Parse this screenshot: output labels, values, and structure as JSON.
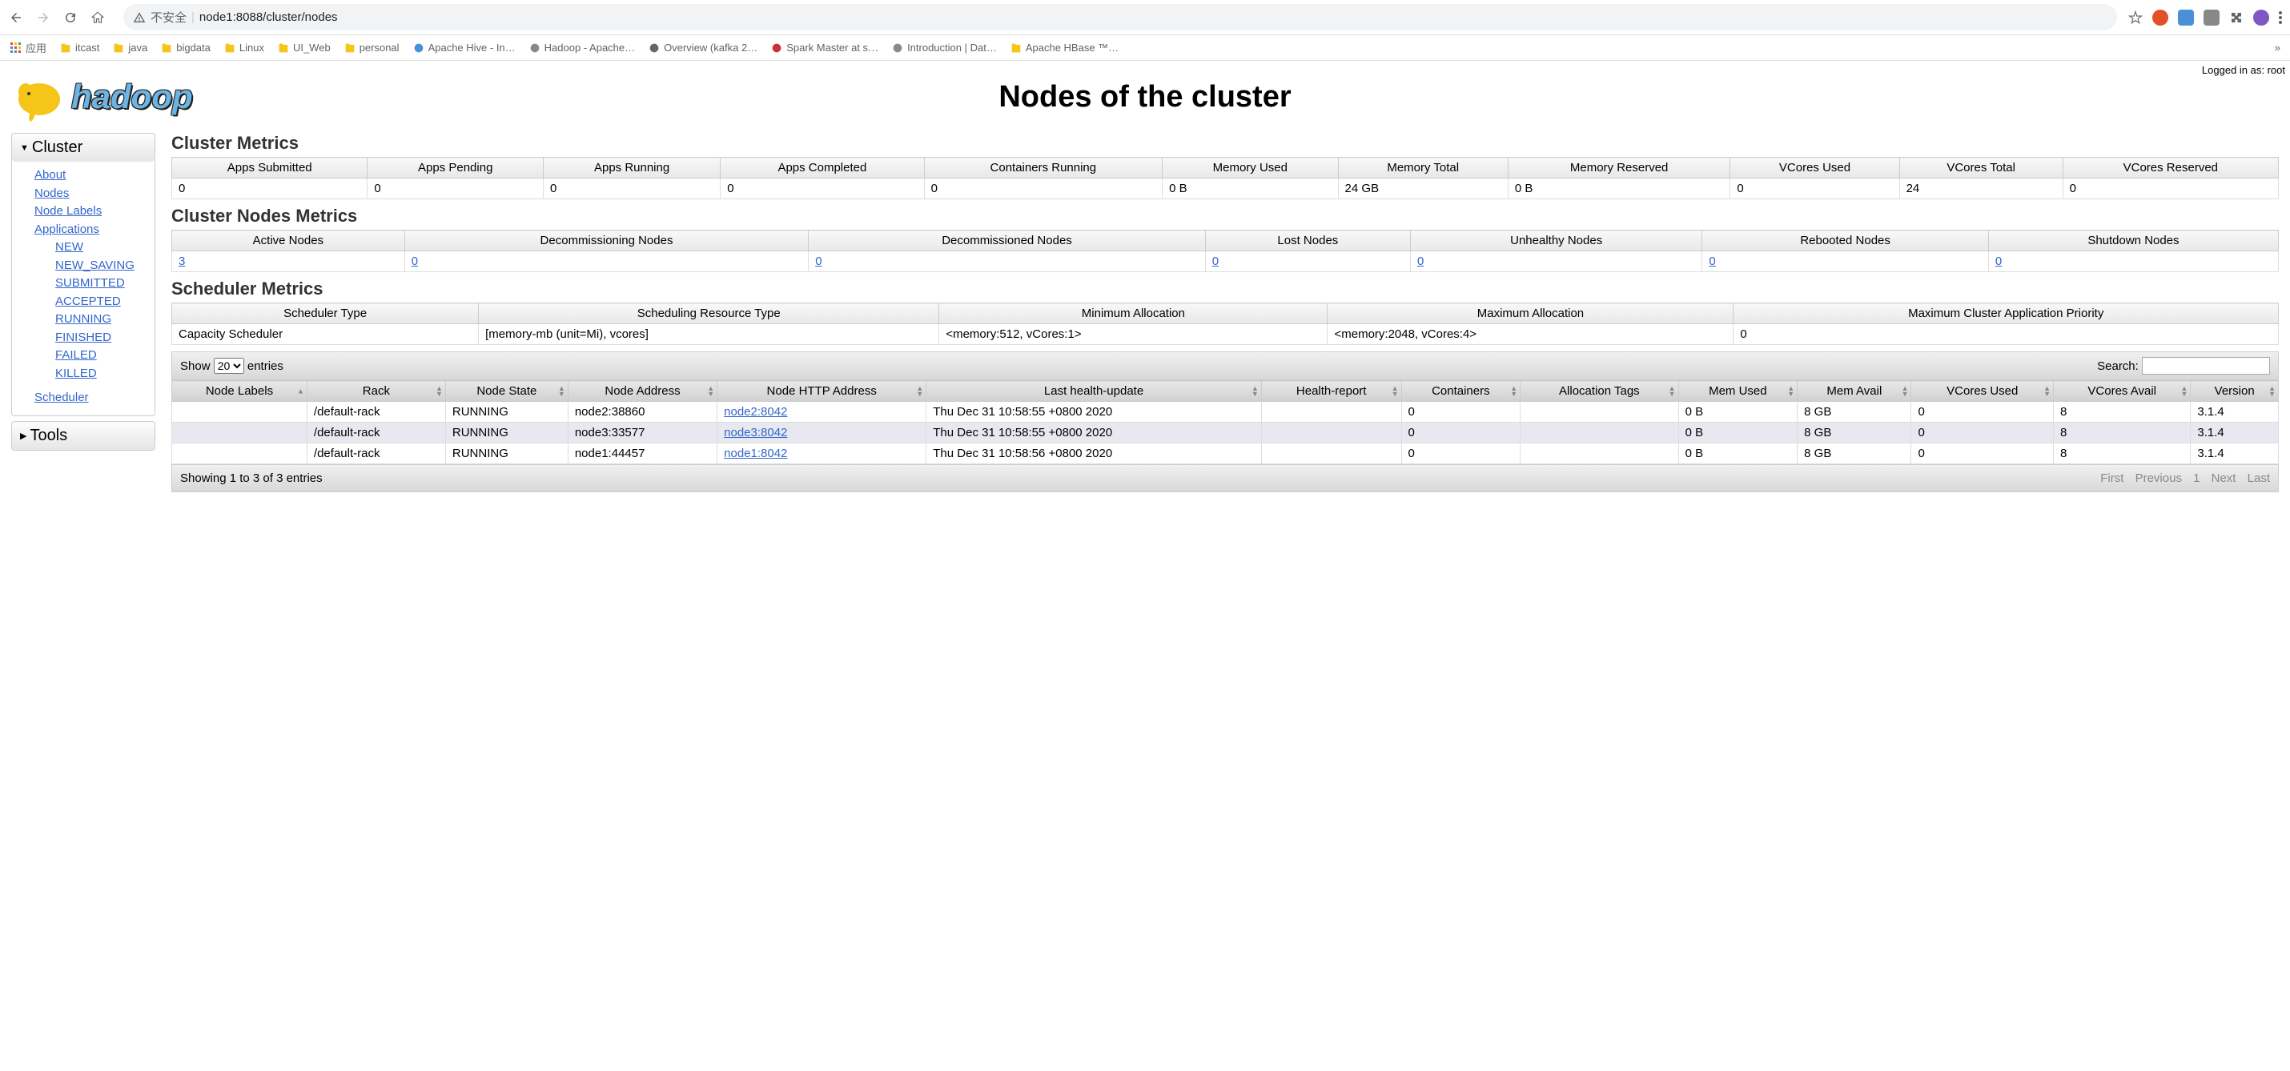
{
  "browser": {
    "unsafe_label": "不安全",
    "url": "node1:8088/cluster/nodes",
    "apps_label": "应用"
  },
  "bookmarks": [
    {
      "label": "itcast",
      "color": "#F5C518"
    },
    {
      "label": "java",
      "color": "#F5C518"
    },
    {
      "label": "bigdata",
      "color": "#F5C518"
    },
    {
      "label": "Linux",
      "color": "#F5C518"
    },
    {
      "label": "UI_Web",
      "color": "#F5C518"
    },
    {
      "label": "personal",
      "color": "#F5C518"
    },
    {
      "label": "Apache Hive - In…",
      "color": "#4A90D9"
    },
    {
      "label": "Hadoop - Apache…",
      "color": "#888"
    },
    {
      "label": "Overview (kafka 2…",
      "color": "#666"
    },
    {
      "label": "Spark Master at s…",
      "color": "#CC3333"
    },
    {
      "label": "Introduction | Dat…",
      "color": "#888"
    },
    {
      "label": "Apache HBase ™…",
      "color": "#F5C518"
    }
  ],
  "page_title": "Nodes of the cluster",
  "logged_in": "Logged in as: root",
  "sidebar": {
    "cluster_label": "Cluster",
    "tools_label": "Tools",
    "items": {
      "about": "About",
      "nodes": "Nodes",
      "node_labels": "Node Labels",
      "applications": "Applications",
      "new": "NEW",
      "new_saving": "NEW_SAVING",
      "submitted": "SUBMITTED",
      "accepted": "ACCEPTED",
      "running": "RUNNING",
      "finished": "FINISHED",
      "failed": "FAILED",
      "killed": "KILLED",
      "scheduler": "Scheduler"
    }
  },
  "cluster_metrics": {
    "heading": "Cluster Metrics",
    "headers": [
      "Apps Submitted",
      "Apps Pending",
      "Apps Running",
      "Apps Completed",
      "Containers Running",
      "Memory Used",
      "Memory Total",
      "Memory Reserved",
      "VCores Used",
      "VCores Total",
      "VCores Reserved"
    ],
    "values": [
      "0",
      "0",
      "0",
      "0",
      "0",
      "0 B",
      "24 GB",
      "0 B",
      "0",
      "24",
      "0"
    ]
  },
  "cluster_nodes_metrics": {
    "heading": "Cluster Nodes Metrics",
    "headers": [
      "Active Nodes",
      "Decommissioning Nodes",
      "Decommissioned Nodes",
      "Lost Nodes",
      "Unhealthy Nodes",
      "Rebooted Nodes",
      "Shutdown Nodes"
    ],
    "values": [
      "3",
      "0",
      "0",
      "0",
      "0",
      "0",
      "0"
    ]
  },
  "scheduler_metrics": {
    "heading": "Scheduler Metrics",
    "headers": [
      "Scheduler Type",
      "Scheduling Resource Type",
      "Minimum Allocation",
      "Maximum Allocation",
      "Maximum Cluster Application Priority"
    ],
    "values": [
      "Capacity Scheduler",
      "[memory-mb (unit=Mi), vcores]",
      "<memory:512, vCores:1>",
      "<memory:2048, vCores:4>",
      "0"
    ]
  },
  "datatable": {
    "show_label": "Show",
    "entries_label": "entries",
    "page_size": "20",
    "search_label": "Search:",
    "search_value": "",
    "columns": [
      "Node Labels",
      "Rack",
      "Node State",
      "Node Address",
      "Node HTTP Address",
      "Last health-update",
      "Health-report",
      "Containers",
      "Allocation Tags",
      "Mem Used",
      "Mem Avail",
      "VCores Used",
      "VCores Avail",
      "Version"
    ],
    "rows": [
      {
        "labels": "",
        "rack": "/default-rack",
        "state": "RUNNING",
        "address": "node2:38860",
        "http": "node2:8042",
        "health_update": "Thu Dec 31 10:58:55 +0800 2020",
        "health_report": "",
        "containers": "0",
        "alloc_tags": "",
        "mem_used": "0 B",
        "mem_avail": "8 GB",
        "vcores_used": "0",
        "vcores_avail": "8",
        "version": "3.1.4"
      },
      {
        "labels": "",
        "rack": "/default-rack",
        "state": "RUNNING",
        "address": "node3:33577",
        "http": "node3:8042",
        "health_update": "Thu Dec 31 10:58:55 +0800 2020",
        "health_report": "",
        "containers": "0",
        "alloc_tags": "",
        "mem_used": "0 B",
        "mem_avail": "8 GB",
        "vcores_used": "0",
        "vcores_avail": "8",
        "version": "3.1.4"
      },
      {
        "labels": "",
        "rack": "/default-rack",
        "state": "RUNNING",
        "address": "node1:44457",
        "http": "node1:8042",
        "health_update": "Thu Dec 31 10:58:56 +0800 2020",
        "health_report": "",
        "containers": "0",
        "alloc_tags": "",
        "mem_used": "0 B",
        "mem_avail": "8 GB",
        "vcores_used": "0",
        "vcores_avail": "8",
        "version": "3.1.4"
      }
    ],
    "showing": "Showing 1 to 3 of 3 entries",
    "pager": {
      "first": "First",
      "prev": "Previous",
      "page": "1",
      "next": "Next",
      "last": "Last"
    }
  },
  "chart_data": {
    "type": "table",
    "title": "Nodes of the cluster",
    "columns": [
      "Node Labels",
      "Rack",
      "Node State",
      "Node Address",
      "Node HTTP Address",
      "Last health-update",
      "Health-report",
      "Containers",
      "Allocation Tags",
      "Mem Used",
      "Mem Avail",
      "VCores Used",
      "VCores Avail",
      "Version"
    ],
    "rows": [
      [
        "",
        "/default-rack",
        "RUNNING",
        "node2:38860",
        "node2:8042",
        "Thu Dec 31 10:58:55 +0800 2020",
        "",
        0,
        "",
        "0 B",
        "8 GB",
        0,
        8,
        "3.1.4"
      ],
      [
        "",
        "/default-rack",
        "RUNNING",
        "node3:33577",
        "node3:8042",
        "Thu Dec 31 10:58:55 +0800 2020",
        "",
        0,
        "",
        "0 B",
        "8 GB",
        0,
        8,
        "3.1.4"
      ],
      [
        "",
        "/default-rack",
        "RUNNING",
        "node1:44457",
        "node1:8042",
        "Thu Dec 31 10:58:56 +0800 2020",
        "",
        0,
        "",
        "0 B",
        "8 GB",
        0,
        8,
        "3.1.4"
      ]
    ]
  }
}
